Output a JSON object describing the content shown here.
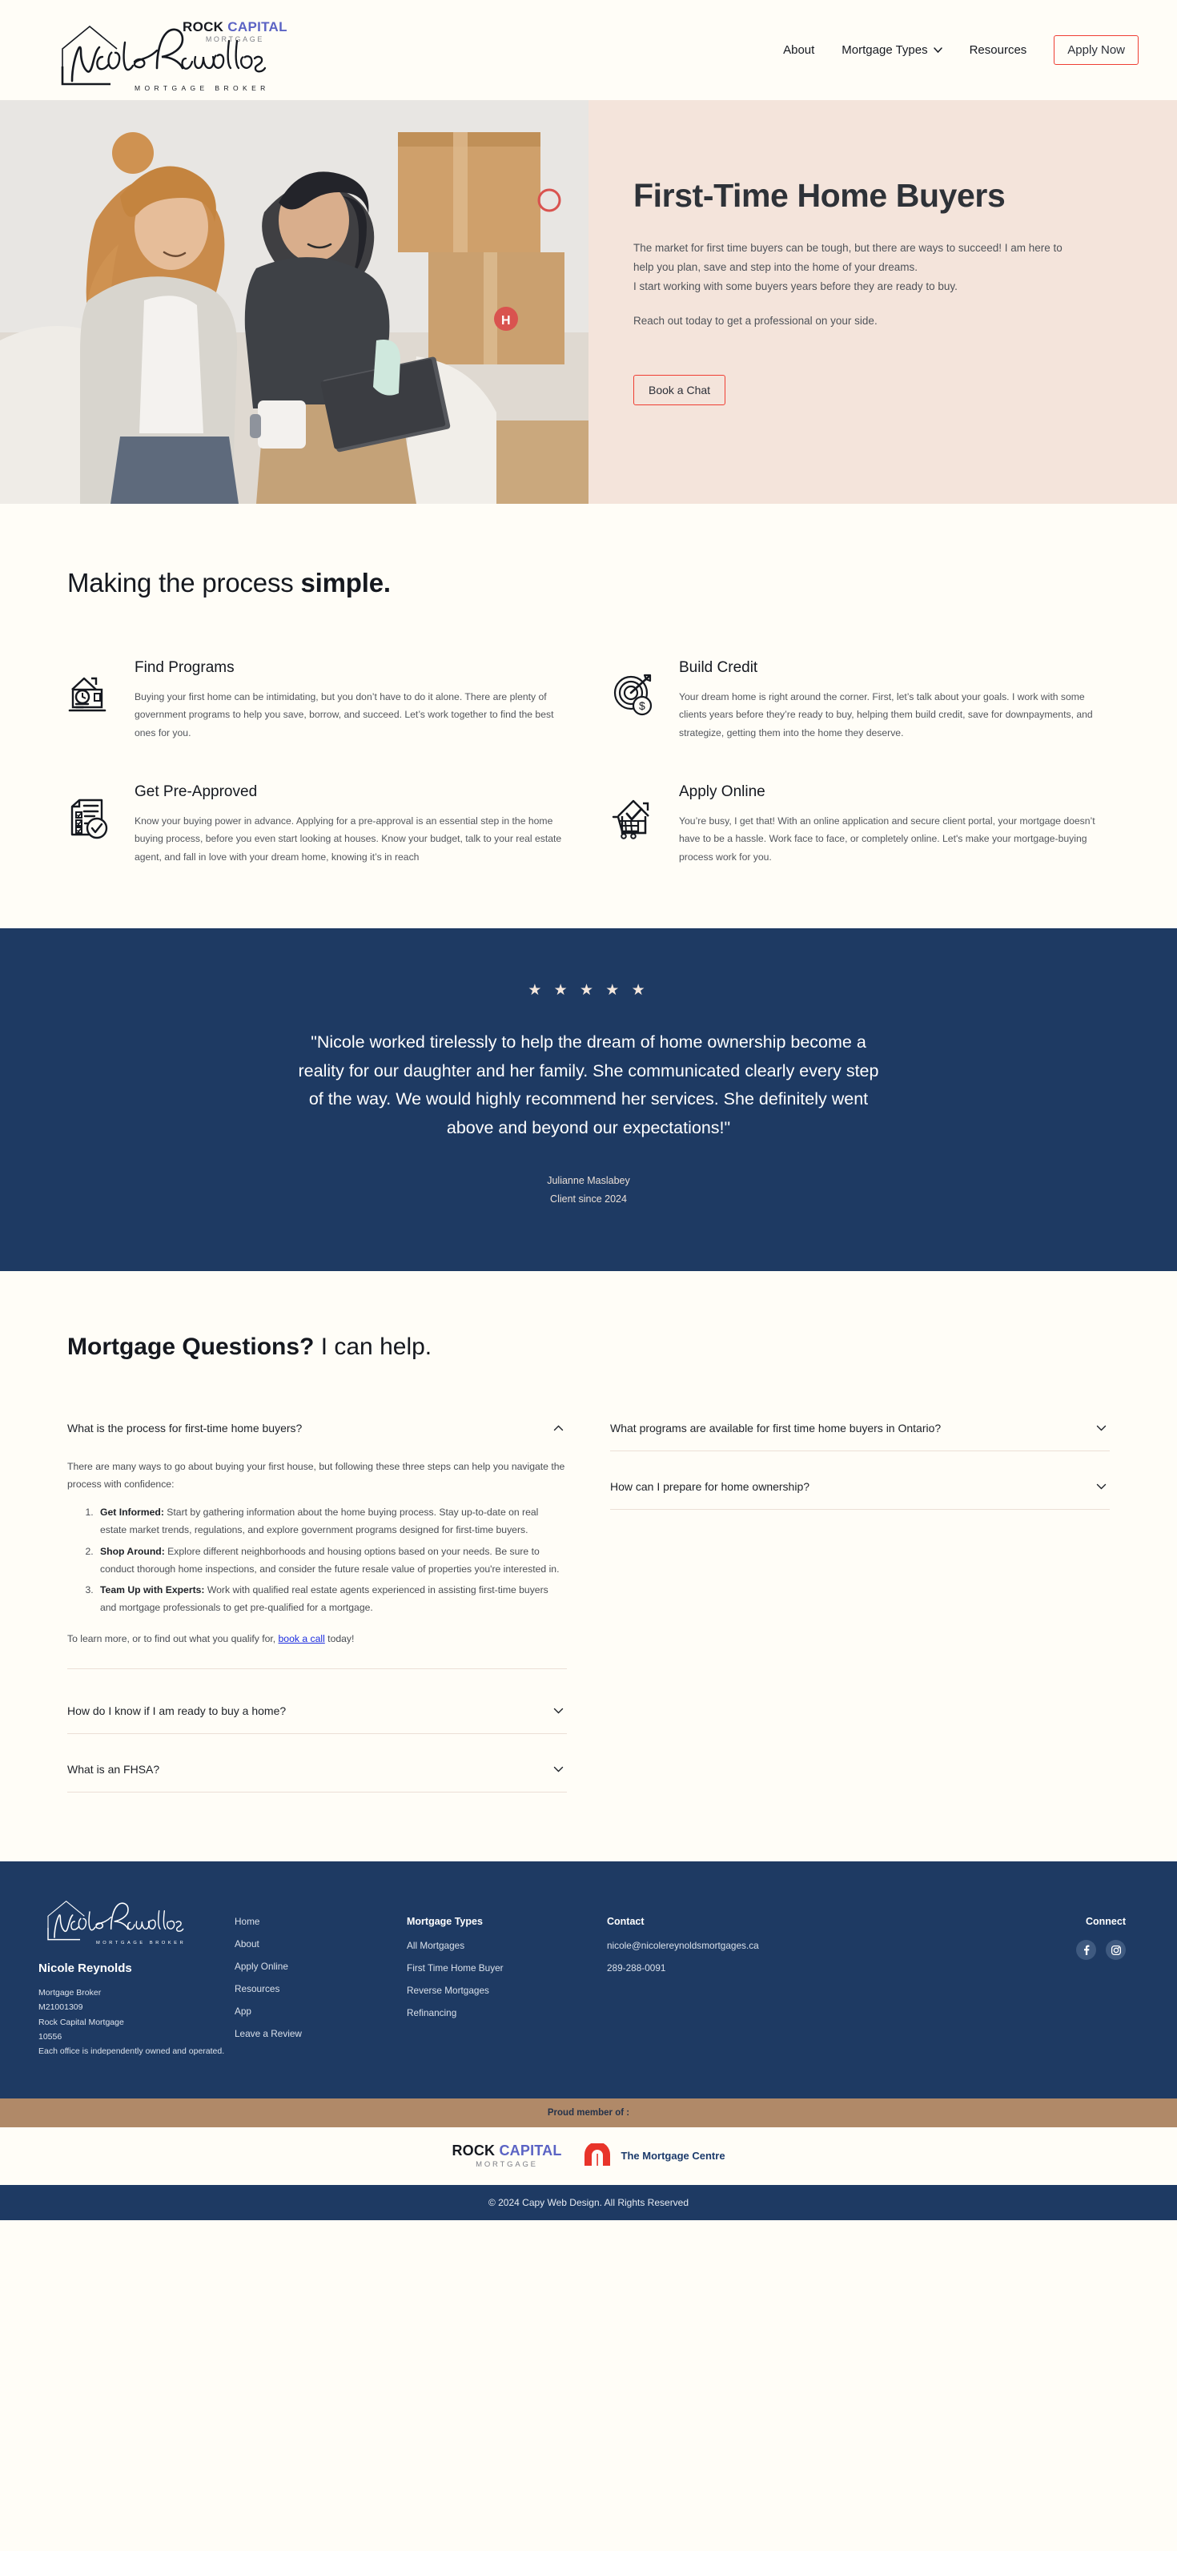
{
  "brand": {
    "logo_name": "Nicole Reynolds",
    "logo_tagline": "MORTGAGE BROKER",
    "rock_capital": {
      "rock": "ROCK",
      "capital": "CAPITAL",
      "sub": "MORTGAGE"
    },
    "accent_red": "#ef3e33",
    "navy": "#1e3a63",
    "cream": "#fffdf7",
    "blush": "#f4e4db",
    "tan": "#b08968"
  },
  "nav": {
    "items": [
      {
        "label": "About",
        "caret": false
      },
      {
        "label": "Mortgage Types",
        "caret": true
      },
      {
        "label": "Resources",
        "caret": false
      }
    ],
    "cta": "Apply Now"
  },
  "hero": {
    "title": "First-Time Home Buyers",
    "para1": "The market for first time buyers can be tough, but there are ways to succeed! I am here to help you plan, save and step into the home of your dreams.",
    "para2": "I start working with some buyers years before they are ready to buy.",
    "para3": "Reach out today to get a professional on your side.",
    "cta": "Book a Chat"
  },
  "process": {
    "heading_light": "Making the process ",
    "heading_bold": "simple.",
    "cards": [
      {
        "icon": "house-document-check-icon",
        "title": "Find Programs",
        "body": "Buying your first home can be intimidating, but you don’t have to do it alone. There are plenty of government programs to help you save, borrow, and succeed. Let’s work together to find the best ones for you."
      },
      {
        "icon": "target-dollar-icon",
        "title": "Build Credit",
        "body": "Your dream home is right around the corner. First, let’s talk about your goals. I work with some clients years before they’re ready to buy, helping them build credit, save for downpayments, and strategize, getting them into the home they deserve."
      },
      {
        "icon": "checklist-approved-icon",
        "title": "Get Pre-Approved",
        "body": "Know your buying power in advance. Applying for a pre-approval is an essential step in the home buying process, before you even start looking at houses. Know your budget, talk to your real estate agent, and fall in love with your dream home, knowing it’s in reach"
      },
      {
        "icon": "house-cart-check-icon",
        "title": "Apply Online",
        "body": "You’re busy, I get that! With an online application and secure client portal, your mortgage doesn’t have to be a hassle. Work face to face, or completely online. Let's make your mortgage-buying process work for you."
      }
    ]
  },
  "testimonial": {
    "stars": "★ ★ ★ ★ ★",
    "star_count": 5,
    "quote": "\"Nicole worked tirelessly to help the dream of home ownership become a reality for our daughter and her family. She communicated clearly every step of the way. We would highly recommend her services. She definitely went above and beyond our expectations!\"",
    "author": "Julianne Maslabey",
    "since": "Client since 2024"
  },
  "faq": {
    "heading_bold": "Mortgage Questions?",
    "heading_light": " I can help.",
    "left": [
      {
        "question": "What is the process for first-time home buyers?",
        "open": true,
        "intro": "There are many ways to go about buying your first house, but following these three steps can help you navigate the process with confidence:",
        "steps": [
          {
            "lead": "Get Informed:",
            "text": " Start by gathering information about the home buying process. Stay up-to-date on  real estate market trends, regulations, and explore government programs designed for first-time buyers."
          },
          {
            "lead": "Shop Around:",
            "text": " Explore different neighborhoods and housing options based on your needs. Be sure to conduct thorough home inspections, and consider the future resale value of properties you're interested in."
          },
          {
            "lead": "Team Up with Experts:",
            "text": " Work with qualified real estate agents experienced in assisting first-time buyers and mortgage professionals to get pre-qualified for a mortgage."
          }
        ],
        "outro_pre": "To learn more, or to find out what you qualify for, ",
        "outro_link": "book a call",
        "outro_post": " today!"
      },
      {
        "question": "How do I know if I am ready to buy a home?",
        "open": false
      },
      {
        "question": "What is an FHSA?",
        "open": false
      }
    ],
    "right": [
      {
        "question": "What programs are available for first time home buyers in Ontario?",
        "open": false
      },
      {
        "question": "How can I prepare for home ownership?",
        "open": false
      }
    ]
  },
  "footer": {
    "brand_name": "Nicole Reynolds",
    "meta": [
      "Mortgage Broker",
      "M21001309",
      "Rock Capital Mortgage",
      "10556",
      "Each office is independently owned and operated."
    ],
    "nav_links": [
      "Home",
      "About",
      "Apply Online",
      "Resources",
      "App",
      "Leave a Review"
    ],
    "mortgage_types_head": "Mortgage Types",
    "mortgage_types": [
      "All Mortgages",
      "First Time Home Buyer",
      "Reverse Mortgages",
      "Refinancing"
    ],
    "contact_head": "Contact",
    "contact": [
      "nicole@nicolereynoldsmortgages.ca",
      "289-288-0091"
    ],
    "connect_head": "Connect",
    "socials": [
      {
        "name": "facebook-icon",
        "glyph": "f"
      },
      {
        "name": "instagram-icon",
        "glyph": ""
      }
    ],
    "proud_member": "Proud member of :",
    "partner_mortgage_centre": "The Mortgage Centre",
    "copyright": "© 2024 Capy Web Design. All Rights Reserved"
  }
}
